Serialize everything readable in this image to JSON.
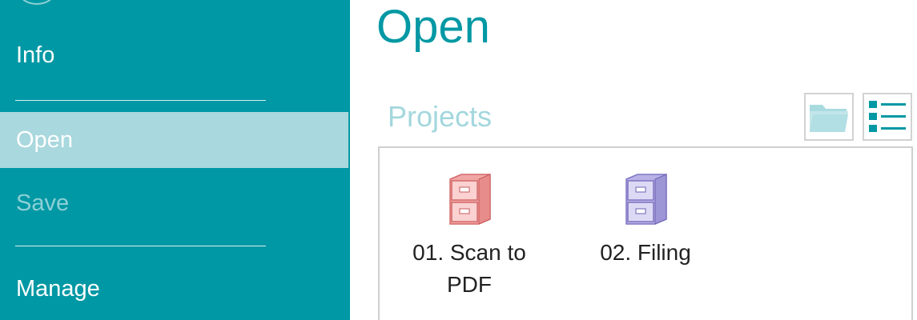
{
  "sidebar": {
    "items": [
      {
        "label": "Info"
      },
      {
        "label": "Open"
      },
      {
        "label": "Save"
      },
      {
        "label": "Manage"
      }
    ]
  },
  "main": {
    "title": "Open",
    "section_title": "Projects",
    "projects": [
      {
        "label": "01. Scan to PDF",
        "icon": "cabinet-red-icon"
      },
      {
        "label": "02. Filing",
        "icon": "cabinet-purple-icon"
      }
    ]
  },
  "colors": {
    "sidebar_bg": "#0098a4",
    "selected_item_bg": "#a9d8de",
    "accent": "#0098a4",
    "section_title": "#a3d7dd"
  }
}
